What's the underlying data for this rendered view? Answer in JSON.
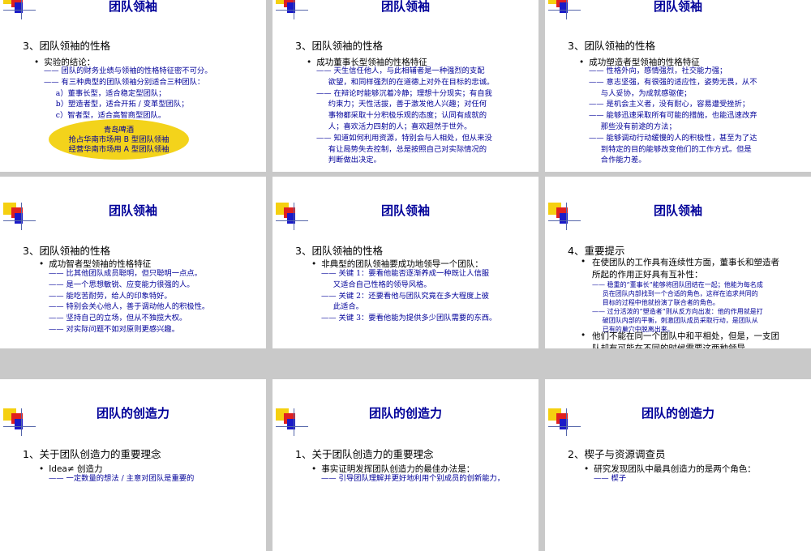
{
  "slides": [
    {
      "title": "团队领袖",
      "heading": "3、团队领袖的性格",
      "bullet": "实验的结论：",
      "lines": "—— 团队的财务业绩与领袖的性格特征密不可分。\n—— 有三种典型的团队领袖分别适合三种团队：\n     a）董事长型，适合稳定型团队；\n     b）塑造者型，适合开拓 / 变革型团队；\n     c）智者型，适合高智商型团队。",
      "ellipse": "青岛啤酒\n抢占华南市场用 B 型团队领袖\n经营华南市场用 A 型团队领袖"
    },
    {
      "title": "团队领袖",
      "heading": "3、团队领袖的性格",
      "bullet": "成功董事长型领袖的性格特征",
      "lines": "—— 天生信任他人，与此相辅者是一种强烈的支配\n     欲望，和同样强烈的在道德上对外在目标的忠诚。\n—— 在辩论时能够沉着冷静；理想十分现实；有自我\n     约束力；天性活拔，善于激发他人兴趣；对任何\n     事物都采取十分积极乐观的态度；认同有成就的\n     人；喜欢活力四射的人；喜欢超然于世外。\n—— 知道如何利用资源，特别会与人相处，但从来没\n     有让局势失去控制，总是按照自己对实际情况的\n     判断做出决定。"
    },
    {
      "title": "团队领袖",
      "heading": "3、团队领袖的性格",
      "bullet": "成功塑造者型领袖的性格特征",
      "lines": "—— 性格外向，感情强烈，社交能力强；\n—— 意志坚强，有很强的适应性，姿势无畏，从不\n     与人妥协，为成就感驱使；\n—— 是机会主义者，没有耐心，容易遭受挫折；\n—— 能够迅速采取所有可能的措施，也能迅速改弃\n     那些没有前途的方法；\n—— 能够调动行动缓慢的人的积极性，甚至为了达\n     到特定的目的能够改变他们的工作方式。但是\n     合作能力差。"
    },
    {
      "title": "团队领袖",
      "heading": "3、团队领袖的性格",
      "bullet": "成功智者型领袖的性格特征",
      "lines": "—— 比其他团队成员聪明，但只聪明一点点。\n—— 是一个思想敏锐、应变能力很强的人。\n—— 能吃苦耐劳，给人的印象特好。\n—— 特别会关心他人，善于调动他人的积极性。\n—— 坚持自己的立场，但从不独揽大权。\n—— 对实际问题不如对原则更感兴趣。"
    },
    {
      "title": "团队领袖",
      "heading": "3、团队领袖的性格",
      "bullet": "非典型的团队领袖要成功地领导一个团队：",
      "lines": "—— 关键 1：要看他能否逐渐养成一种既让人信服\n     又适合自己性格的领导风格。\n—— 关键 2：还要看他与团队究竟在多大程度上彼\n     此适合。\n—— 关键 3：要看他能为提供多少团队需要的东西。"
    },
    {
      "title": "团队领袖",
      "heading": "4、重要提示",
      "bullet": "在使团队的工作具有连续性方面，董事长和塑造者\n所起的作用正好具有互补性：",
      "lines": "—— 稳重的“董事长”能够将团队团结在一起；他能为每名成\n     员在团队内部找到一个合适的角色，这样在追求共同的\n     目标的过程中他就扮演了联合者的角色。\n—— 过分活泼的“塑造者”则从反方向出发：他的作用就是打\n     破团队内部的平衡，刺激团队成员采取行动，是团队从\n     已有的巢穴中脱离出来。",
      "bullet2": "他们不能在同一个团队中和平相处，但是，一支团\n队却有可能在不同的时候需要这两种领导"
    },
    {
      "title": "团队的创造力",
      "heading": "1、关于团队创造力的重要理念",
      "bullet": "Idea≠ 创造力",
      "lines": "—— 一定数量的想法 / 主意对团队是重要的"
    },
    {
      "title": "团队的创造力",
      "heading": "1、关于团队创造力的重要理念",
      "bullet": "事实证明发挥团队创造力的最佳办法是：",
      "lines": "—— 引导团队理解并更好地利用个别成员的创新能力，"
    },
    {
      "title": "团队的创造力",
      "heading": "2、楔子与资源调查员",
      "bullet": "研究发现团队中最具创造力的是两个角色：",
      "lines": "—— 楔子"
    }
  ]
}
